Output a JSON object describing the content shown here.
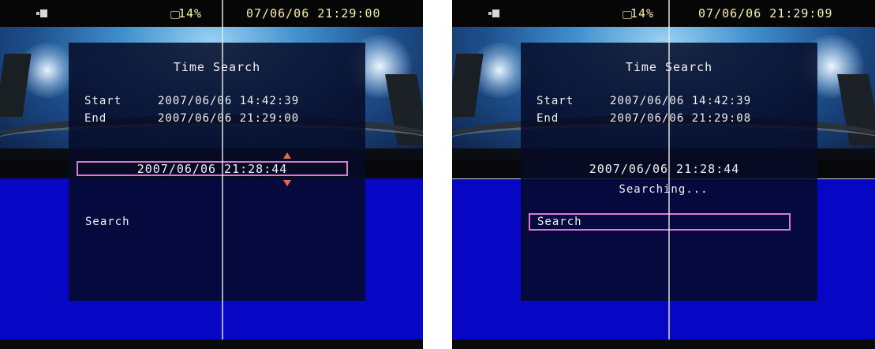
{
  "screens": [
    {
      "status": {
        "battery_pct": "14%",
        "datetime": "07/06/06 21:29:00"
      },
      "dialog": {
        "title": "Time Search",
        "start_label": "Start",
        "start_value": "2007/06/06 14:42:39",
        "end_label": "End",
        "end_value": "2007/06/06 21:29:00",
        "search_time": "2007/06/06 21:28:44",
        "search_label": "Search"
      }
    },
    {
      "status": {
        "battery_pct": "14%",
        "datetime": "07/06/06 21:29:09"
      },
      "dialog": {
        "title": "Time Search",
        "start_label": "Start",
        "start_value": "2007/06/06 14:42:39",
        "end_label": "End",
        "end_value": "2007/06/06 21:29:08",
        "search_time": "2007/06/06 21:28:44",
        "searching_text": "Searching...",
        "search_label": "Search"
      }
    }
  ],
  "colors": {
    "status_text": "#f6f0a4",
    "focus_border": "#d879d8",
    "stepper_arrow": "#e06a4c",
    "blue_background": "#0606c4"
  },
  "icons": [
    "camera-icon",
    "battery-icon",
    "arrow-up-icon",
    "arrow-down-icon"
  ]
}
